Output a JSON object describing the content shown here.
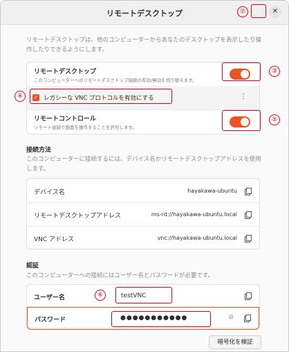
{
  "window": {
    "title": "リモートデスクトップ"
  },
  "intro": "リモートデスクトップは、他のコンピューターからあなたのデスクトップを表示したり操作したりできるようにします。",
  "remote_desktop": {
    "label": "リモートデスクトップ",
    "description": "このコンピューターへのリモートデスクトップ接続の有効/無効を切り替えます。",
    "enabled": true
  },
  "legacy_vnc": {
    "label": "レガシーな VNC プロトコルを有効にする",
    "checked": true,
    "menu_glyph": "⋮"
  },
  "remote_control": {
    "label": "リモートコントロール",
    "description": "リモート接続で画面を操作することを許可します。",
    "enabled": true
  },
  "connection": {
    "heading": "接続方法",
    "description": "このコンピューターに接続するには、デバイス名かリモートデスクトップアドレスを使用します。",
    "rows": [
      {
        "label": "デバイス名",
        "value": "hayakawa-ubuntu"
      },
      {
        "label": "リモートデスクトップアドレス",
        "value": "ms-rd://hayakawa-ubuntu.local"
      },
      {
        "label": "VNC アドレス",
        "value": "vnc://hayakawa-ubuntu.local"
      }
    ]
  },
  "auth": {
    "heading": "認証",
    "description": "このコンピューターへの接続にはユーザー名とパスワードが必要です。",
    "username_label": "ユーザー名",
    "username_value": "testVNC",
    "password_label": "パスワード",
    "password_value": "●●●●●●●●●●●"
  },
  "verify_button": "暗号化を検証",
  "callouts": [
    "③",
    "④",
    "⑤",
    "⑥",
    "⑦"
  ],
  "colors": {
    "accent": "#e95420",
    "annotation": "#e0001b"
  },
  "icons": [
    "close-icon",
    "copy-icon",
    "checkbox-icon",
    "kebab-menu-icon",
    "visibility-off-icon"
  ]
}
